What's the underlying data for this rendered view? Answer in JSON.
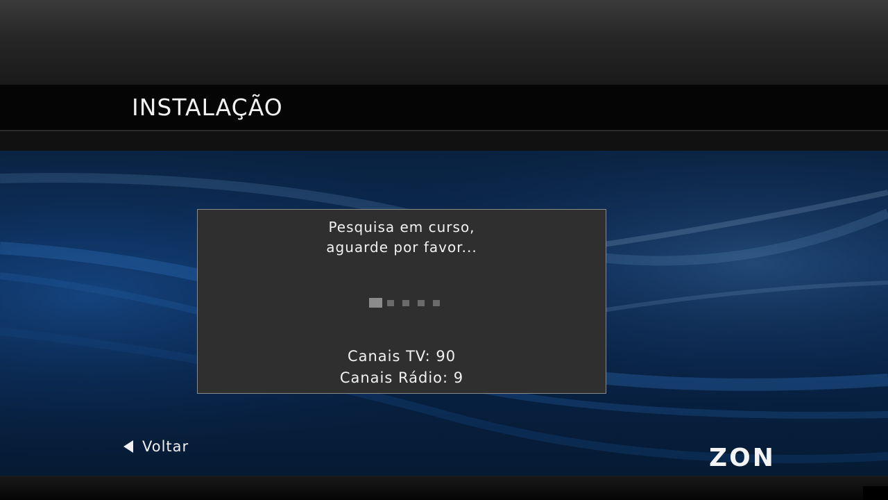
{
  "header": {
    "title": "INSTALAÇÃO"
  },
  "dialog": {
    "message_line1": "Pesquisa em curso,",
    "message_line2": "aguarde por favor...",
    "progress": {
      "total_steps": 5,
      "active_step": 1
    },
    "tv_channels_label": "Canais TV: 90",
    "radio_channels_label": "Canais Rádio: 9"
  },
  "footer": {
    "back_label": "Voltar",
    "back_icon": "triangle-left-icon",
    "logo_text": "ZON"
  },
  "colors": {
    "background_blue": "#0b2a55",
    "dialog_background": "#2f2f2f",
    "text": "#f2f2f2"
  }
}
